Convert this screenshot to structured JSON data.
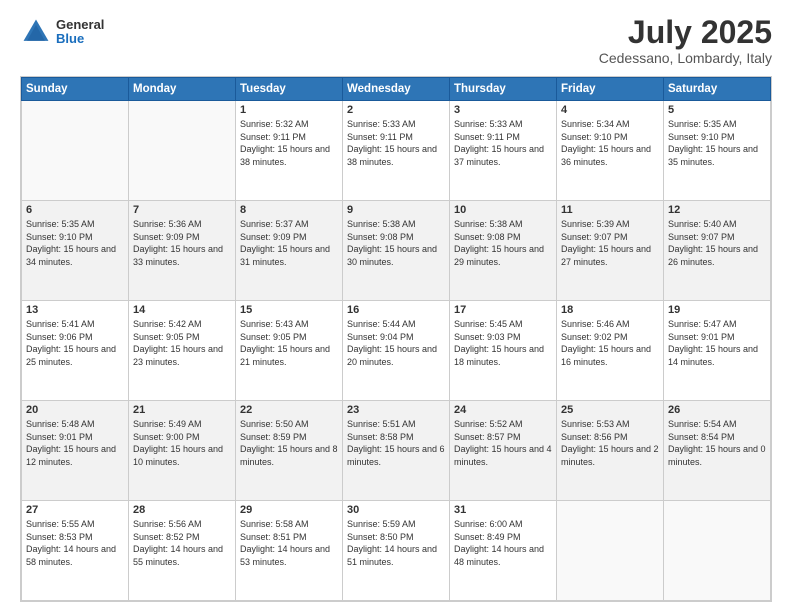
{
  "header": {
    "logo": {
      "general": "General",
      "blue": "Blue"
    },
    "title": "July 2025",
    "subtitle": "Cedessano, Lombardy, Italy"
  },
  "calendar": {
    "weekdays": [
      "Sunday",
      "Monday",
      "Tuesday",
      "Wednesday",
      "Thursday",
      "Friday",
      "Saturday"
    ],
    "weeks": [
      [
        {
          "day": "",
          "info": ""
        },
        {
          "day": "",
          "info": ""
        },
        {
          "day": "1",
          "info": "Sunrise: 5:32 AM\nSunset: 9:11 PM\nDaylight: 15 hours\nand 38 minutes."
        },
        {
          "day": "2",
          "info": "Sunrise: 5:33 AM\nSunset: 9:11 PM\nDaylight: 15 hours\nand 38 minutes."
        },
        {
          "day": "3",
          "info": "Sunrise: 5:33 AM\nSunset: 9:11 PM\nDaylight: 15 hours\nand 37 minutes."
        },
        {
          "day": "4",
          "info": "Sunrise: 5:34 AM\nSunset: 9:10 PM\nDaylight: 15 hours\nand 36 minutes."
        },
        {
          "day": "5",
          "info": "Sunrise: 5:35 AM\nSunset: 9:10 PM\nDaylight: 15 hours\nand 35 minutes."
        }
      ],
      [
        {
          "day": "6",
          "info": "Sunrise: 5:35 AM\nSunset: 9:10 PM\nDaylight: 15 hours\nand 34 minutes."
        },
        {
          "day": "7",
          "info": "Sunrise: 5:36 AM\nSunset: 9:09 PM\nDaylight: 15 hours\nand 33 minutes."
        },
        {
          "day": "8",
          "info": "Sunrise: 5:37 AM\nSunset: 9:09 PM\nDaylight: 15 hours\nand 31 minutes."
        },
        {
          "day": "9",
          "info": "Sunrise: 5:38 AM\nSunset: 9:08 PM\nDaylight: 15 hours\nand 30 minutes."
        },
        {
          "day": "10",
          "info": "Sunrise: 5:38 AM\nSunset: 9:08 PM\nDaylight: 15 hours\nand 29 minutes."
        },
        {
          "day": "11",
          "info": "Sunrise: 5:39 AM\nSunset: 9:07 PM\nDaylight: 15 hours\nand 27 minutes."
        },
        {
          "day": "12",
          "info": "Sunrise: 5:40 AM\nSunset: 9:07 PM\nDaylight: 15 hours\nand 26 minutes."
        }
      ],
      [
        {
          "day": "13",
          "info": "Sunrise: 5:41 AM\nSunset: 9:06 PM\nDaylight: 15 hours\nand 25 minutes."
        },
        {
          "day": "14",
          "info": "Sunrise: 5:42 AM\nSunset: 9:05 PM\nDaylight: 15 hours\nand 23 minutes."
        },
        {
          "day": "15",
          "info": "Sunrise: 5:43 AM\nSunset: 9:05 PM\nDaylight: 15 hours\nand 21 minutes."
        },
        {
          "day": "16",
          "info": "Sunrise: 5:44 AM\nSunset: 9:04 PM\nDaylight: 15 hours\nand 20 minutes."
        },
        {
          "day": "17",
          "info": "Sunrise: 5:45 AM\nSunset: 9:03 PM\nDaylight: 15 hours\nand 18 minutes."
        },
        {
          "day": "18",
          "info": "Sunrise: 5:46 AM\nSunset: 9:02 PM\nDaylight: 15 hours\nand 16 minutes."
        },
        {
          "day": "19",
          "info": "Sunrise: 5:47 AM\nSunset: 9:01 PM\nDaylight: 15 hours\nand 14 minutes."
        }
      ],
      [
        {
          "day": "20",
          "info": "Sunrise: 5:48 AM\nSunset: 9:01 PM\nDaylight: 15 hours\nand 12 minutes."
        },
        {
          "day": "21",
          "info": "Sunrise: 5:49 AM\nSunset: 9:00 PM\nDaylight: 15 hours\nand 10 minutes."
        },
        {
          "day": "22",
          "info": "Sunrise: 5:50 AM\nSunset: 8:59 PM\nDaylight: 15 hours\nand 8 minutes."
        },
        {
          "day": "23",
          "info": "Sunrise: 5:51 AM\nSunset: 8:58 PM\nDaylight: 15 hours\nand 6 minutes."
        },
        {
          "day": "24",
          "info": "Sunrise: 5:52 AM\nSunset: 8:57 PM\nDaylight: 15 hours\nand 4 minutes."
        },
        {
          "day": "25",
          "info": "Sunrise: 5:53 AM\nSunset: 8:56 PM\nDaylight: 15 hours\nand 2 minutes."
        },
        {
          "day": "26",
          "info": "Sunrise: 5:54 AM\nSunset: 8:54 PM\nDaylight: 15 hours\nand 0 minutes."
        }
      ],
      [
        {
          "day": "27",
          "info": "Sunrise: 5:55 AM\nSunset: 8:53 PM\nDaylight: 14 hours\nand 58 minutes."
        },
        {
          "day": "28",
          "info": "Sunrise: 5:56 AM\nSunset: 8:52 PM\nDaylight: 14 hours\nand 55 minutes."
        },
        {
          "day": "29",
          "info": "Sunrise: 5:58 AM\nSunset: 8:51 PM\nDaylight: 14 hours\nand 53 minutes."
        },
        {
          "day": "30",
          "info": "Sunrise: 5:59 AM\nSunset: 8:50 PM\nDaylight: 14 hours\nand 51 minutes."
        },
        {
          "day": "31",
          "info": "Sunrise: 6:00 AM\nSunset: 8:49 PM\nDaylight: 14 hours\nand 48 minutes."
        },
        {
          "day": "",
          "info": ""
        },
        {
          "day": "",
          "info": ""
        }
      ]
    ]
  }
}
